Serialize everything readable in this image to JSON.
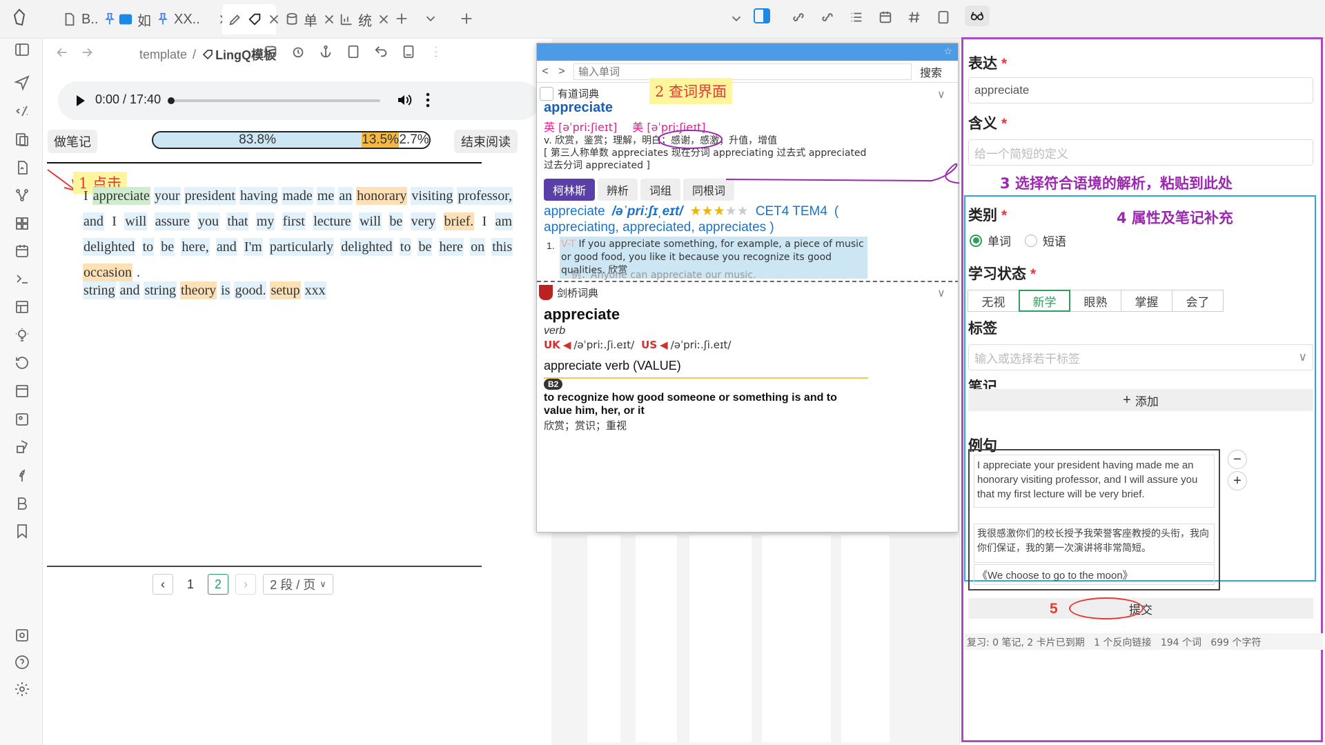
{
  "tabs": [
    {
      "label": "B..",
      "icon": "file-icon"
    },
    {
      "label": "如",
      "icon": "kanban-icon"
    },
    {
      "label": "XX..",
      "icon": ""
    },
    {
      "label": "",
      "icon": "pen-icon"
    },
    {
      "label": "单",
      "icon": "database-icon"
    },
    {
      "label": "统",
      "icon": "chart-icon"
    }
  ],
  "editor": {
    "breadcrumb_parent": "template",
    "breadcrumb_sep": "/",
    "breadcrumb_title": "LingQ模板",
    "audio_time": "0:00 / 17:40",
    "take_notes_label": "做笔记",
    "end_reading_label": "结束阅读",
    "progress": [
      {
        "label": "83.8%",
        "value": 83.8,
        "color": "#cde6f4"
      },
      {
        "label": "13.5%",
        "value": 13.5,
        "color": "#f5b942"
      },
      {
        "label": "2.7%",
        "value": 2.7,
        "color": "#ffffff"
      }
    ],
    "annotation_1": "1 点击",
    "paragraph1": [
      {
        "t": "I",
        "s": ""
      },
      {
        "t": "appreciate",
        "s": "green"
      },
      {
        "t": "your",
        "s": "blue"
      },
      {
        "t": "president",
        "s": "blue"
      },
      {
        "t": "having",
        "s": "blue"
      },
      {
        "t": "made",
        "s": "blue"
      },
      {
        "t": "me",
        "s": "blue"
      },
      {
        "t": "an",
        "s": "blue"
      },
      {
        "t": "honorary",
        "s": "orange"
      },
      {
        "t": "visiting",
        "s": "blue"
      },
      {
        "t": "professor,",
        "s": "blue"
      },
      {
        "t": "and",
        "s": "blue"
      },
      {
        "t": "I",
        "s": ""
      },
      {
        "t": "will",
        "s": "blue"
      },
      {
        "t": "assure",
        "s": "blue"
      },
      {
        "t": "you",
        "s": "blue"
      },
      {
        "t": "that",
        "s": "blue"
      },
      {
        "t": "my",
        "s": "blue"
      },
      {
        "t": "first",
        "s": "blue"
      },
      {
        "t": "lecture",
        "s": "blue"
      },
      {
        "t": "will",
        "s": "blue"
      },
      {
        "t": "be",
        "s": "blue"
      },
      {
        "t": "very",
        "s": "blue"
      },
      {
        "t": "brief.",
        "s": "orange"
      },
      {
        "t": "I",
        "s": ""
      },
      {
        "t": "am",
        "s": "blue"
      },
      {
        "t": "delighted",
        "s": "blue"
      },
      {
        "t": "to",
        "s": "blue"
      },
      {
        "t": "be",
        "s": "blue"
      },
      {
        "t": "here,",
        "s": "blue"
      },
      {
        "t": "and",
        "s": "blue"
      },
      {
        "t": "I'm",
        "s": "blue"
      },
      {
        "t": "particularly",
        "s": "blue"
      },
      {
        "t": "delighted",
        "s": "blue"
      },
      {
        "t": "to",
        "s": "blue"
      },
      {
        "t": "be",
        "s": "blue"
      },
      {
        "t": "here",
        "s": "blue"
      },
      {
        "t": "on",
        "s": "blue"
      },
      {
        "t": "this",
        "s": "blue"
      },
      {
        "t": "occasion",
        "s": "orange"
      },
      {
        "t": ".",
        "s": ""
      }
    ],
    "paragraph2": [
      {
        "t": "string",
        "s": "blue"
      },
      {
        "t": "and",
        "s": "blue"
      },
      {
        "t": "string",
        "s": "blue"
      },
      {
        "t": "theory",
        "s": "orange"
      },
      {
        "t": "is",
        "s": "blue"
      },
      {
        "t": "good.",
        "s": "blue"
      },
      {
        "t": "setup",
        "s": "orange"
      },
      {
        "t": "xxx",
        "s": "blue"
      }
    ],
    "pagination": {
      "pages": [
        "1",
        "2"
      ],
      "current": "2",
      "per_page": "2 段 / 页"
    }
  },
  "dict": {
    "search_placeholder": "输入单词",
    "search_button": "搜索",
    "youdao_name": "有道词典",
    "annotation_2": "2 查词界面",
    "word": "appreciate",
    "phon_uk": "英 [əˈpriːʃieɪt]",
    "phon_us": "美 [əˈpriːʃieɪt]",
    "def_line": "v. 欣赏，鉴赏；理解，明白；感谢，感激；升值，增值",
    "forms_line": "[ 第三人称单数 appreciates 现在分词 appreciating 过去式 appreciated 过去分词 appreciated ]",
    "tabs": [
      "柯林斯",
      "辨析",
      "词组",
      "同根词"
    ],
    "collins_word": "appreciate",
    "collins_phon": "/əˈpriːʃɪˌeɪt/",
    "collins_level": "CET4 TEM4",
    "collins_forms_a": "(",
    "collins_forms_b": "appreciating, appreciated, appreciates )",
    "collins_rating": 3,
    "collins_def_num": "1.",
    "collins_def_tag": "V-T",
    "collins_def": "If you appreciate something, for example, a piece of music or good food, you like it because you recognize its good qualities. 欣赏",
    "collins_example": "例：Anyone can appreciate our music.",
    "cambridge_name": "剑桥词典",
    "camb_word": "appreciate",
    "camb_pos": "verb",
    "camb_uk": "UK",
    "camb_uk_ipa": "/əˈpriː.ʃi.eɪt/",
    "camb_us": "US",
    "camb_us_ipa": "/əˈpriː.ʃi.eɪt/",
    "camb_guide": "appreciate verb (VALUE)",
    "camb_level": "B2",
    "camb_def": "to recognize how good someone or something is and to value him, her, or it",
    "camb_def_cn": "欣赏；赏识；重视"
  },
  "form": {
    "expression_label": "表达",
    "expression_value": "appreciate",
    "meaning_label": "含义",
    "meaning_placeholder": "给一个简短的定义",
    "annotation_3": "3 选择符合语境的解析，粘贴到此处",
    "category_label": "类别",
    "category_options": [
      "单词",
      "短语"
    ],
    "annotation_4": "4 属性及笔记补充",
    "status_label": "学习状态",
    "status_options": [
      "无视",
      "新学",
      "眼熟",
      "掌握",
      "会了"
    ],
    "status_selected": "新学",
    "tags_label": "标签",
    "tags_placeholder": "输入或选择若干标签",
    "notes_label": "笔记",
    "add_label": "添加",
    "examples_label": "例句",
    "example_en": "I appreciate your president having made me an honorary visiting professor, and I will assure you that my first lecture will be very brief.",
    "example_cn": "我很感激你们的校长授予我荣誉客座教授的头衔，我向你们保证，我的第一次演讲将非常简短。",
    "example_source": "《We choose to go to the moon》",
    "annotation_5": "5",
    "submit_label": "提交"
  },
  "statusbar": {
    "text": "复习: 0 笔记, 2 卡片已到期   1 个反向链接   194 个词   699 个字符"
  }
}
